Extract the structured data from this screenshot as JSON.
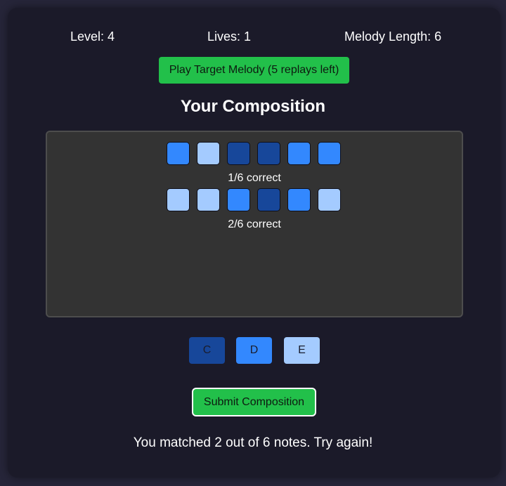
{
  "stats": {
    "level": "Level: 4",
    "lives": "Lives: 1",
    "melody_length": "Melody Length: 6"
  },
  "play_button_label": "Play Target Melody (5 replays left)",
  "title": "Your Composition",
  "note_colors": {
    "C": "#17479a",
    "D": "#3388fe",
    "E": "#a4cbff"
  },
  "attempts": [
    {
      "notes": [
        "D",
        "E",
        "C",
        "C",
        "D",
        "D"
      ],
      "result": "1/6 correct"
    },
    {
      "notes": [
        "E",
        "E",
        "D",
        "C",
        "D",
        "E"
      ],
      "result": "2/6 correct"
    }
  ],
  "note_keys": [
    {
      "label": "C",
      "color": "#17479a"
    },
    {
      "label": "D",
      "color": "#3388fe"
    },
    {
      "label": "E",
      "color": "#a4cbff"
    }
  ],
  "submit_label": "Submit Composition",
  "message": "You matched 2 out of 6 notes. Try again!"
}
